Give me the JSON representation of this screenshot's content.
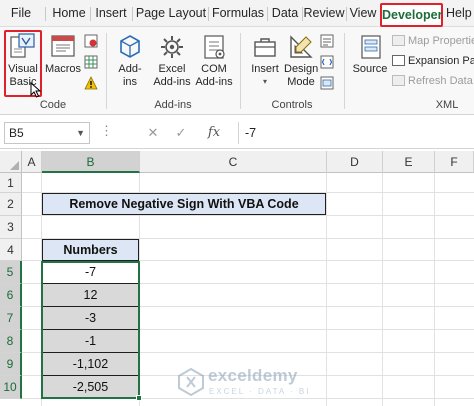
{
  "menu": {
    "tabs": [
      "File",
      "Home",
      "Insert",
      "Page Layout",
      "Formulas",
      "Data",
      "Review",
      "View"
    ],
    "active_tab": "Developer",
    "overflow_tab": "Help"
  },
  "ribbon": {
    "code": {
      "visual_basic": [
        "Visual",
        "Basic"
      ],
      "macros": "Macros",
      "label": "Code"
    },
    "addins": {
      "addins": [
        "Add-",
        "ins"
      ],
      "excel_addins": [
        "Excel",
        "Add-ins"
      ],
      "com_addins": [
        "COM",
        "Add-ins"
      ],
      "label": "Add-ins"
    },
    "controls": {
      "insert": "Insert",
      "design_mode": [
        "Design",
        "Mode"
      ],
      "label": "Controls"
    },
    "xml": {
      "source": "Source",
      "map_properties": "Map Properties",
      "expansion_packs": "Expansion Pac",
      "refresh_data": "Refresh Data",
      "label": "XML"
    }
  },
  "formula_bar": {
    "name_box": "B5",
    "value": "-7"
  },
  "grid": {
    "columns": [
      "A",
      "B",
      "C",
      "D",
      "E",
      "F"
    ],
    "rows": [
      "1",
      "2",
      "3",
      "4",
      "5",
      "6",
      "7",
      "8",
      "9",
      "10"
    ]
  },
  "sheet": {
    "title": "Remove Negative Sign With VBA Code",
    "numbers_header": "Numbers",
    "numbers": [
      "-7",
      "12",
      "-3",
      "-1",
      "-1,102",
      "-2,505"
    ]
  },
  "watermark": {
    "name": "exceldemy",
    "tagline": "EXCEL · DATA · BI"
  },
  "colors": {
    "excel_green": "#217346",
    "highlight_red": "#e0202a",
    "header_fill": "#dce6f4",
    "value_fill": "#d9d9d9"
  }
}
